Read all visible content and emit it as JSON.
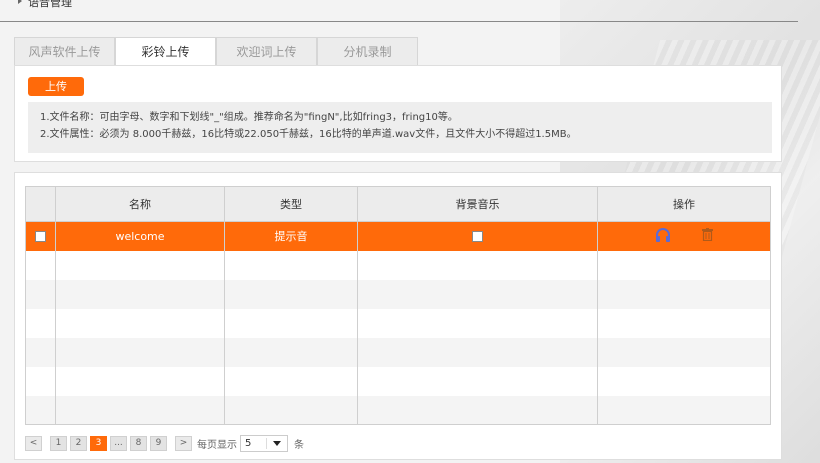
{
  "header": {
    "title": "语音管理"
  },
  "tabs": [
    {
      "label": "风声软件上传",
      "active": false
    },
    {
      "label": "彩铃上传",
      "active": true
    },
    {
      "label": "欢迎词上传",
      "active": false
    },
    {
      "label": "分机录制",
      "active": false
    }
  ],
  "upload": {
    "button_label": "上传",
    "hints": [
      "1.文件名称：可由字母、数字和下划线\"_\"组成。推荐命名为\"fingN\",比如fring3，fring10等。",
      "2.文件属性：必须为 8.000千赫兹，16比特或22.050千赫兹，16比特的单声道.wav文件，且文件大小不得超过1.5MB。"
    ]
  },
  "table": {
    "columns": [
      "名称",
      "类型",
      "背景音乐",
      "操作"
    ],
    "rows": [
      {
        "name": "welcome",
        "type": "提示音",
        "background_music": false,
        "selected": true
      }
    ],
    "empty_rows": 6
  },
  "pager": {
    "pages": [
      "1",
      "2",
      "3",
      "...",
      "8",
      "9"
    ],
    "current": "3",
    "prev_label": "<",
    "next_label": ">",
    "per_page_label": "每页显示",
    "per_page_value": "5",
    "unit_label": "条"
  },
  "colors": {
    "accent": "#ff6a0a",
    "headphone": "#5b6bd6",
    "trash": "#b05a1a"
  },
  "icons": {
    "headphone": "headphones-icon",
    "trash": "trash-icon"
  }
}
